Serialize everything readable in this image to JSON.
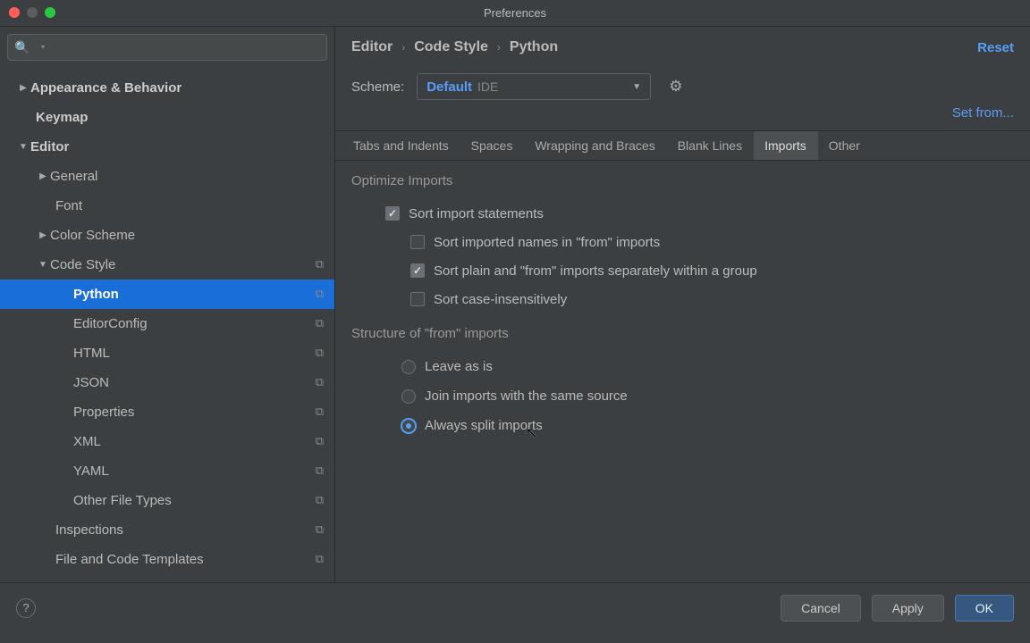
{
  "window": {
    "title": "Preferences"
  },
  "search": {
    "placeholder": ""
  },
  "tree": {
    "appearance": "Appearance & Behavior",
    "keymap": "Keymap",
    "editor": "Editor",
    "general": "General",
    "font": "Font",
    "color_scheme": "Color Scheme",
    "code_style": "Code Style",
    "python": "Python",
    "editorconfig": "EditorConfig",
    "html": "HTML",
    "json": "JSON",
    "properties": "Properties",
    "xml": "XML",
    "yaml": "YAML",
    "other_file_types": "Other File Types",
    "inspections": "Inspections",
    "file_code_templates": "File and Code Templates"
  },
  "breadcrumb": {
    "a": "Editor",
    "b": "Code Style",
    "c": "Python"
  },
  "header": {
    "reset": "Reset",
    "scheme_label": "Scheme:",
    "scheme_value": "Default",
    "scheme_tag": "IDE",
    "set_from": "Set from..."
  },
  "tabs": {
    "tabs_indents": "Tabs and Indents",
    "spaces": "Spaces",
    "wrapping": "Wrapping and Braces",
    "blank_lines": "Blank Lines",
    "imports": "Imports",
    "other": "Other"
  },
  "sections": {
    "optimize": "Optimize Imports",
    "structure": "Structure of \"from\" imports"
  },
  "options": {
    "sort_import": "Sort import statements",
    "sort_names": "Sort imported names in \"from\" imports",
    "sort_plain": "Sort plain and \"from\" imports separately within a group",
    "sort_case": "Sort case-insensitively",
    "leave_as_is": "Leave as is",
    "join_same": "Join imports with the same source",
    "always_split": "Always split imports"
  },
  "footer": {
    "cancel": "Cancel",
    "apply": "Apply",
    "ok": "OK"
  }
}
